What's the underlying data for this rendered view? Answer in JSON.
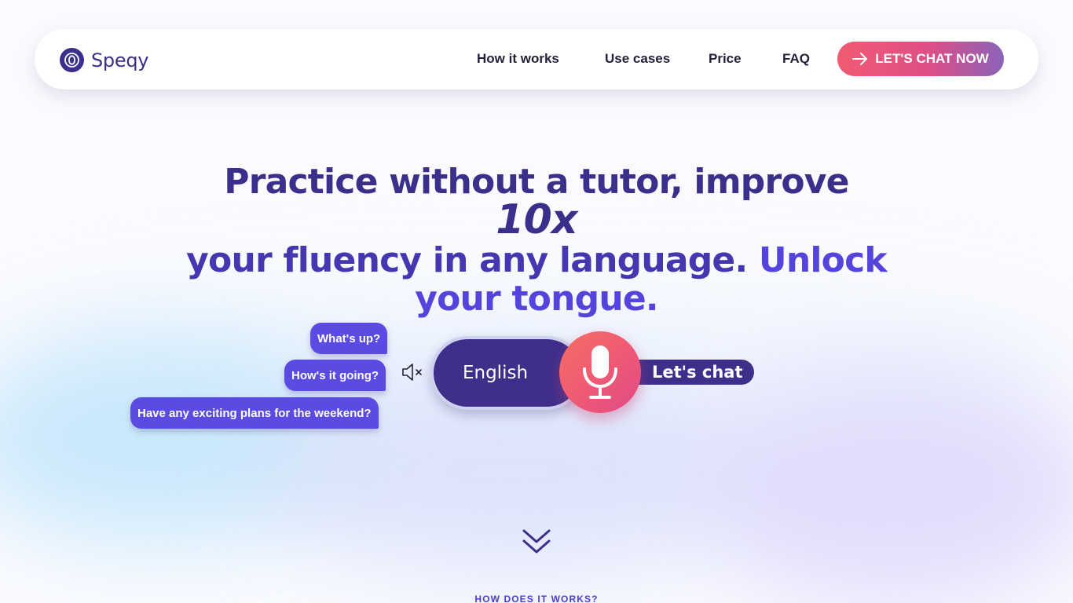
{
  "brand": {
    "name": "Speqy",
    "icon": "logo-icon"
  },
  "nav": {
    "links": [
      "How it works",
      "Use cases",
      "Price",
      "FAQ"
    ],
    "cta_label": "LET'S CHAT NOW",
    "cta_icon": "arrow-right-icon"
  },
  "hero": {
    "line1_a": "Practice without a tutor, improve ",
    "line1_b": "10x",
    "line2_a": "your fluency in any language. ",
    "line2_b": "Unlock",
    "line3": "your tongue."
  },
  "bubbles": [
    "What's up?",
    "How's it going?",
    "Have any exciting plans for the weekend?"
  ],
  "controls": {
    "mute_icon": "speaker-muted-icon",
    "language": "English",
    "mic_icon": "microphone-icon",
    "chat_label": "Let's chat"
  },
  "scroll": {
    "icon": "double-chevron-down-icon"
  },
  "next_section": {
    "label": "HOW DOES IT WORKS?"
  },
  "colors": {
    "primary": "#3b2f8c",
    "accent": "#5a4be2",
    "cta_start": "#f25a72",
    "cta_end": "#8a63b9"
  }
}
